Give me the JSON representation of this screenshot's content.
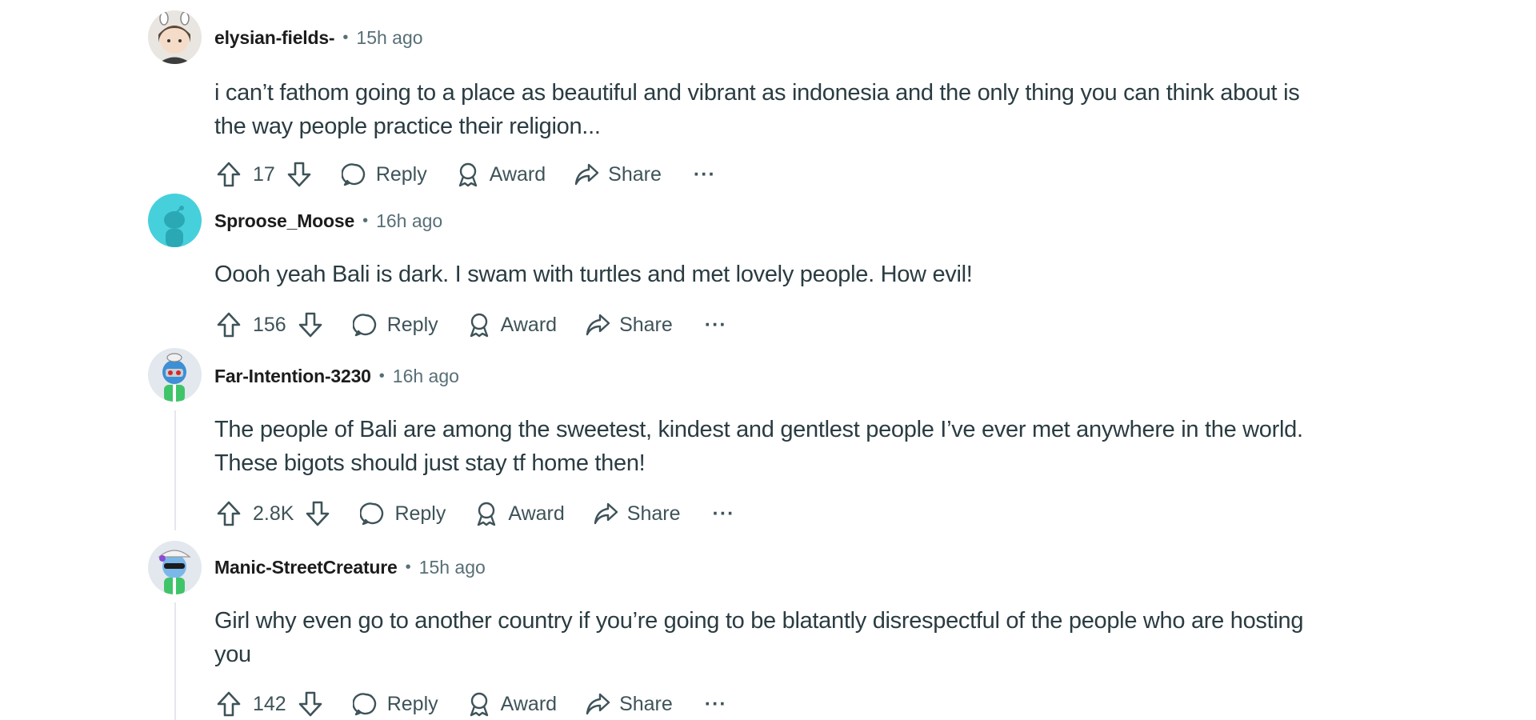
{
  "comments": [
    {
      "username": "elysian-fields-",
      "separator": "•",
      "time": "15h ago",
      "lines": [
        "i can’t fathom going to a place as beautiful and vibrant as indonesia and the only thing you can think about is",
        "the way people practice their religion..."
      ],
      "score": "17"
    },
    {
      "username": "Sproose_Moose",
      "separator": "•",
      "time": "16h ago",
      "lines": [
        "Oooh yeah Bali is dark. I swam with turtles and met lovely people. How evil!"
      ],
      "score": "156"
    },
    {
      "username": "Far-Intention-3230",
      "separator": "•",
      "time": "16h ago",
      "lines": [
        "The people of Bali are among the sweetest, kindest and gentlest people I’ve ever met anywhere in the world.",
        "These bigots should just stay tf home then!"
      ],
      "score": "2.8K"
    },
    {
      "username": "Manic-StreetCreature",
      "separator": "•",
      "time": "15h ago",
      "lines": [
        "Girl why even go to another country if you’re going to be blatantly disrespectful of the people who are hosting",
        "you"
      ],
      "score": "142"
    }
  ],
  "actions": {
    "reply": "Reply",
    "award": "Award",
    "share": "Share",
    "more": "···"
  },
  "colors": {
    "text": "#1c1c1c",
    "body_text": "#2a3c42",
    "meta_text": "#576f76",
    "action_text": "#3e5359",
    "thread_line": "#e5e7eb",
    "avatar_teal": "#46d0dc"
  }
}
